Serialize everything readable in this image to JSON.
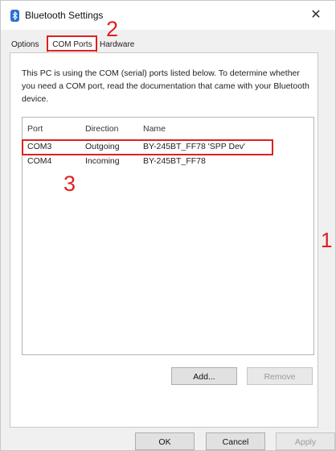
{
  "window": {
    "title": "Bluetooth Settings",
    "close_glyph": "✕",
    "icon": "bluetooth-icon"
  },
  "tabs": {
    "options": "Options",
    "com_ports": "COM Ports",
    "hardware": "Hardware",
    "selected": "COM Ports"
  },
  "description": "This PC is using the COM (serial) ports listed below. To determine whether you need a COM port, read the documentation that came with your Bluetooth device.",
  "ports_table": {
    "headers": [
      "Port",
      "Direction",
      "Name"
    ],
    "rows": [
      [
        "COM3",
        "Outgoing",
        "BY-245BT_FF78 'SPP Dev'"
      ],
      [
        "COM4",
        "Incoming",
        "BY-245BT_FF78"
      ]
    ]
  },
  "buttons": {
    "add": "Add...",
    "remove": "Remove",
    "ok": "OK",
    "cancel": "Cancel",
    "apply": "Apply"
  },
  "annotations": {
    "step_1": "1",
    "step_2": "2",
    "step_3": "3",
    "color": "#e02020"
  },
  "colors": {
    "bluetooth": "#2b6fd6"
  }
}
